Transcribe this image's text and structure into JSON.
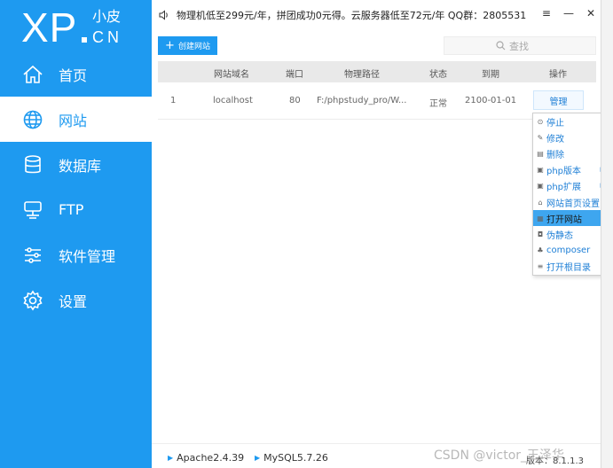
{
  "logo": {
    "main": "XP",
    "sub": "小皮",
    "cn": "CN"
  },
  "sidebar": {
    "items": [
      {
        "label": "首页",
        "icon": "home-icon"
      },
      {
        "label": "网站",
        "icon": "globe-icon",
        "active": true
      },
      {
        "label": "数据库",
        "icon": "database-icon"
      },
      {
        "label": "FTP",
        "icon": "ftp-server-icon"
      },
      {
        "label": "软件管理",
        "icon": "sliders-icon"
      },
      {
        "label": "设置",
        "icon": "gear-icon"
      }
    ]
  },
  "topbar": {
    "notice": "物理机低至299元/年，拼团成功0元得。云服务器低至72元/年 QQ群：2805531",
    "menu_glyph": "≡",
    "minimize_glyph": "—",
    "close_glyph": "✕"
  },
  "toolbar": {
    "create_label": "创建网站",
    "search_placeholder": "查找"
  },
  "table": {
    "headers": [
      "网站域名",
      "端口",
      "物理路径",
      "状态",
      "到期",
      "操作"
    ],
    "rows": [
      {
        "index": "1",
        "domain": "localhost",
        "port": "80",
        "path": "F:/phpstudy_pro/W...",
        "status": "正常",
        "expire": "2100-01-01",
        "action": "管理"
      }
    ]
  },
  "context_menu": {
    "items": [
      {
        "label": "停止",
        "icon": "stop-icon"
      },
      {
        "label": "修改",
        "icon": "pencil-icon"
      },
      {
        "label": "删除",
        "icon": "trash-icon"
      },
      {
        "label": "php版本",
        "icon": "php-version-icon",
        "submenu": true
      },
      {
        "label": "php扩展",
        "icon": "php-extension-icon",
        "submenu": true
      },
      {
        "label": "网站首页设置",
        "icon": "homepage-icon"
      },
      {
        "label": "打开网站",
        "icon": "open-site-icon",
        "highlight": true
      },
      {
        "label": "伪静态",
        "icon": "rewrite-icon"
      },
      {
        "label": "composer",
        "icon": "composer-icon"
      },
      {
        "label": "打开根目录",
        "icon": "folder-list-icon"
      }
    ]
  },
  "bottom": {
    "services": [
      "Apache2.4.39",
      "MySQL5.7.26"
    ],
    "watermark": "CSDN @victor_王泽华",
    "version": "版本：8.1.1.3"
  },
  "colors": {
    "sidebar": "#1e9af0",
    "accent": "#1e9af0",
    "highlight": "#3ea6ef"
  }
}
